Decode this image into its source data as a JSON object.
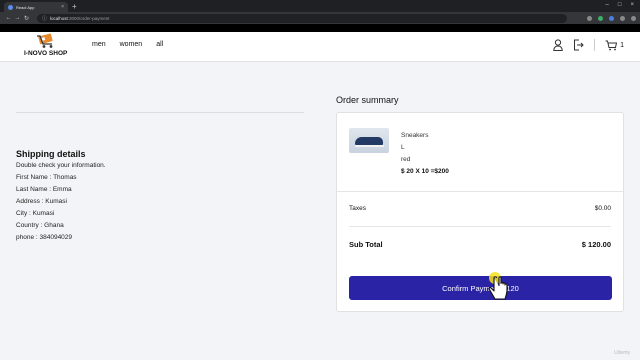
{
  "browser": {
    "tab_title": "React App",
    "url_host": "localhost",
    "url_path": ":3000/order-payment"
  },
  "header": {
    "logo_text": "I-NOVO SHOP",
    "nav": [
      "men",
      "women",
      "all"
    ],
    "cart_count": "1"
  },
  "shipping": {
    "title": "Shipping details",
    "subtitle": "Double check your information.",
    "first_name": "First Name : Thomas",
    "last_name": "Last Name : Emma",
    "address": "Address : Kumasi",
    "city": "City : Kumasi",
    "country": "Country : Ghana",
    "phone": "phone : 384094029"
  },
  "summary": {
    "title": "Order summary",
    "item": {
      "name": "Sneakers",
      "size": "L",
      "color": "red",
      "price_line": "$ 20 X 10 =$200"
    },
    "taxes_label": "Taxes",
    "taxes_value": "$0.00",
    "subtotal_label": "Sub Total",
    "subtotal_value": "$ 120.00",
    "confirm_label": "Confirm Payment $120"
  },
  "colors": {
    "accent": "#2b23a6",
    "page_bg": "#f3f4f7"
  },
  "watermark": "Udemy"
}
